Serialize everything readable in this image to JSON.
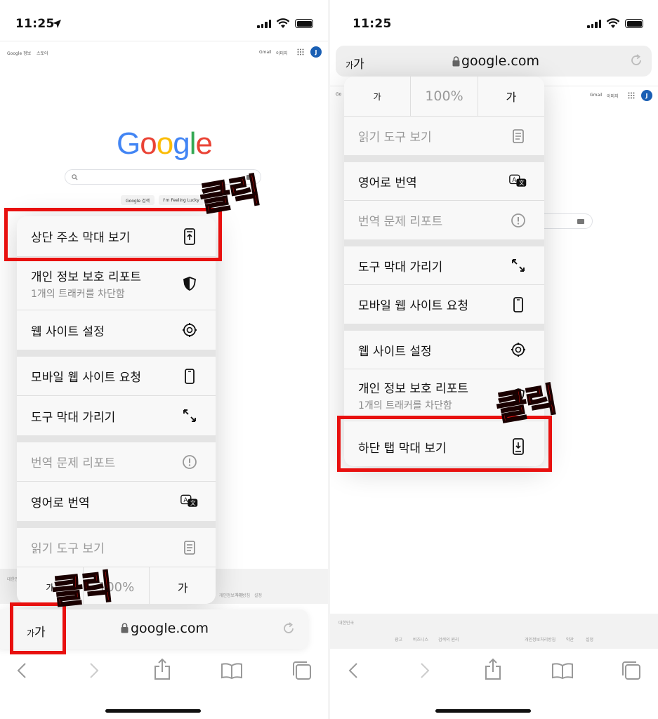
{
  "status": {
    "time": "11:25"
  },
  "google": {
    "logo_letters": [
      {
        "ch": "G",
        "color": "#4285F4"
      },
      {
        "ch": "o",
        "color": "#EA4335"
      },
      {
        "ch": "o",
        "color": "#FBBC05"
      },
      {
        "ch": "g",
        "color": "#4285F4"
      },
      {
        "ch": "l",
        "color": "#34A853"
      },
      {
        "ch": "e",
        "color": "#EA4335"
      }
    ],
    "header_left": [
      "Google 정보",
      "스토어"
    ],
    "header_right": [
      "Gmail",
      "이미지"
    ],
    "avatar": "J",
    "buttons": [
      "Google 검색",
      "I'm Feeling Lucky"
    ],
    "footer_country": "대한민국",
    "footer_links_left": [
      "광고",
      "비즈니스",
      "검색의 원리"
    ],
    "footer_links_right": [
      "개인정보처리방침",
      "약관",
      "설정"
    ]
  },
  "address": {
    "aa_label": "가가",
    "domain": "google.com"
  },
  "left_menu": {
    "items": [
      {
        "label": "상단 주소 막대 보기",
        "icon": "top-bar-icon"
      },
      {
        "label": "개인 정보 보호 리포트",
        "sub": "1개의 트래커를 차단함",
        "icon": "shield-icon"
      },
      {
        "label": "웹 사이트 설정",
        "icon": "gear-icon"
      },
      {
        "label": "모바일 웹 사이트 요청",
        "icon": "phone-icon"
      },
      {
        "label": "도구 막대 가리기",
        "icon": "expand-arrows-icon"
      },
      {
        "label": "번역 문제 리포트",
        "icon": "exclamation-icon"
      },
      {
        "label": "영어로 번역",
        "icon": "translate-icon"
      },
      {
        "label": "읽기 도구 보기",
        "icon": "reader-icon"
      }
    ],
    "font_small": "가",
    "zoom": "100%",
    "font_large": "가"
  },
  "right_menu": {
    "font_small": "가",
    "zoom": "100%",
    "font_large": "가",
    "items": [
      {
        "label": "읽기 도구 보기",
        "icon": "reader-icon"
      },
      {
        "label": "영어로 번역",
        "icon": "translate-icon"
      },
      {
        "label": "번역 문제 리포트",
        "icon": "exclamation-icon"
      },
      {
        "label": "도구 막대 가리기",
        "icon": "expand-arrows-icon"
      },
      {
        "label": "모바일 웹 사이트 요청",
        "icon": "phone-icon"
      },
      {
        "label": "웹 사이트 설정",
        "icon": "gear-icon"
      },
      {
        "label": "개인 정보 보호 리포트",
        "sub": "1개의 트래커를 차단함",
        "icon": "shield-icon"
      },
      {
        "label": "하단 탭 막대 보기",
        "icon": "bottom-bar-icon"
      }
    ]
  },
  "annotations": {
    "click_label": "클릭",
    "highlight_color": "#e8100f"
  }
}
